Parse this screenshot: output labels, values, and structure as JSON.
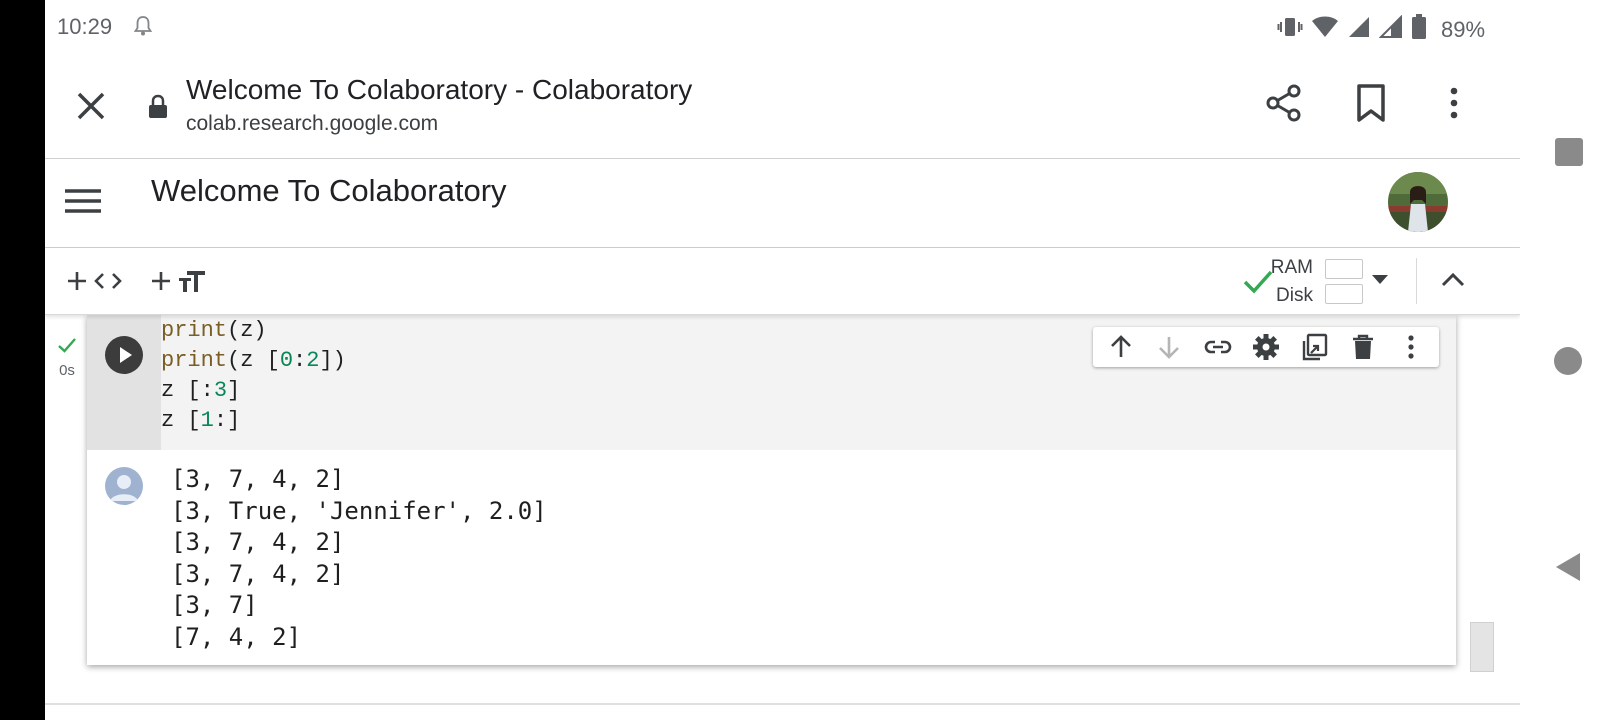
{
  "status_bar": {
    "time": "10:29",
    "battery": "89%",
    "icons": [
      "bell-icon",
      "vibrate-icon",
      "wifi-icon",
      "signal-icon",
      "signal-icon",
      "battery-icon"
    ]
  },
  "browser": {
    "page_title": "Welcome To Colaboratory - Colaboratory",
    "url": "colab.research.google.com"
  },
  "notebook": {
    "title": "Welcome To Colaboratory"
  },
  "toolbar": {
    "add_code_icon": "code-icon",
    "add_text_icon": "text-icon",
    "ram_label": "RAM",
    "disk_label": "Disk",
    "ram_usage": 0.0,
    "disk_usage": 0.0,
    "accent": "#34a853"
  },
  "cell": {
    "exec_time": "0s",
    "code_lines": [
      [
        {
          "t": "print",
          "c": "kw"
        },
        {
          "t": "(z)",
          "c": ""
        }
      ],
      [
        {
          "t": "print",
          "c": "kw"
        },
        {
          "t": "(z [",
          "c": ""
        },
        {
          "t": "0",
          "c": "num"
        },
        {
          "t": ":",
          "c": ""
        },
        {
          "t": "2",
          "c": "num"
        },
        {
          "t": "])",
          "c": ""
        }
      ],
      [
        {
          "t": "z [:",
          "c": ""
        },
        {
          "t": "3",
          "c": "num"
        },
        {
          "t": "]",
          "c": ""
        }
      ],
      [
        {
          "t": "z [",
          "c": ""
        },
        {
          "t": "1",
          "c": "num"
        },
        {
          "t": ":]",
          "c": ""
        }
      ]
    ],
    "output_lines": [
      "[3, 7, 4, 2]",
      "[3, True, 'Jennifer', 2.0]",
      "[3, 7, 4, 2]",
      "[3, 7, 4, 2]",
      "[3, 7]",
      "[7, 4, 2]"
    ],
    "cell_toolbar_icons": [
      "arrow-up-icon",
      "arrow-down-icon",
      "link-icon",
      "gear-icon",
      "mirror-cell-icon",
      "trash-icon",
      "more-vert-icon"
    ]
  }
}
